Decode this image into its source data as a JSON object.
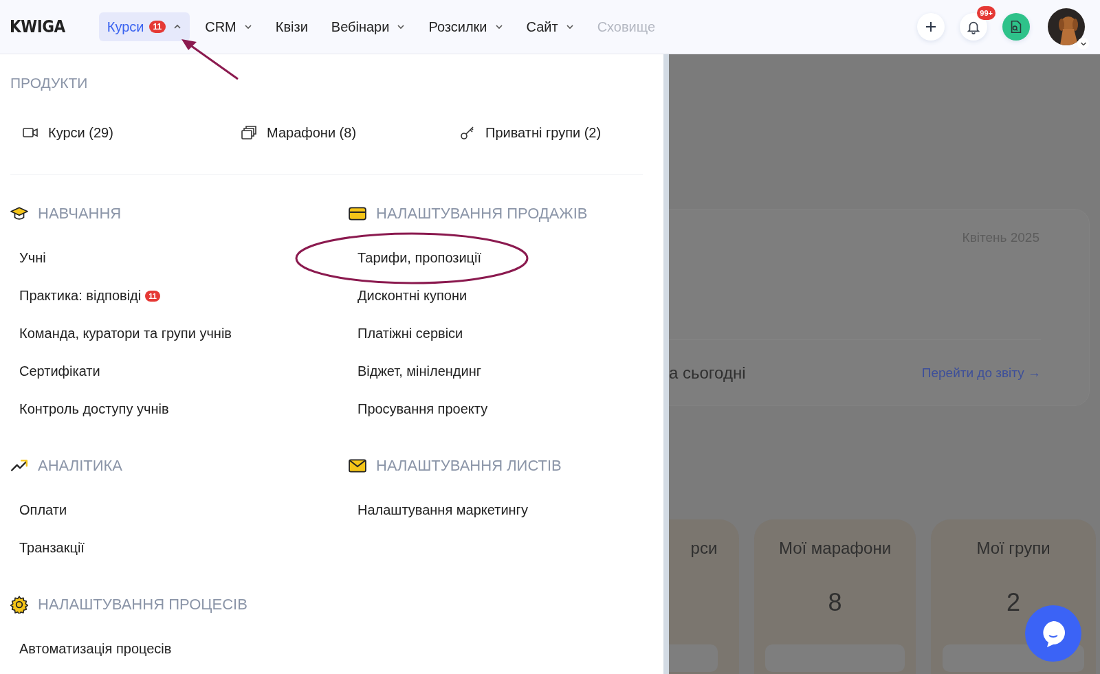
{
  "header": {
    "logo": "KWIGA",
    "nav": [
      {
        "label": "Курси",
        "badge": "11",
        "kind": "dropdown",
        "selected": true,
        "disabled": false
      },
      {
        "label": "CRM",
        "kind": "dropdown",
        "selected": false,
        "disabled": false
      },
      {
        "label": "Квізи",
        "kind": "link",
        "selected": false,
        "disabled": false
      },
      {
        "label": "Вебінари",
        "kind": "dropdown",
        "selected": false,
        "disabled": false
      },
      {
        "label": "Розсилки",
        "kind": "dropdown",
        "selected": false,
        "disabled": false
      },
      {
        "label": "Сайт",
        "kind": "dropdown",
        "selected": false,
        "disabled": false
      },
      {
        "label": "Сховище",
        "kind": "link",
        "selected": false,
        "disabled": true
      }
    ],
    "notifications_badge": "99+"
  },
  "menu": {
    "products_title": "ПРОДУКТИ",
    "products": [
      {
        "label": "Курси (29)"
      },
      {
        "label": "Марафони (8)"
      },
      {
        "label": "Приватні групи (2)"
      }
    ],
    "columns": [
      [
        {
          "title": "НАВЧАННЯ",
          "items": [
            {
              "label": "Учні"
            },
            {
              "label": "Практика: відповіді",
              "badge": "11"
            },
            {
              "label": "Команда, куратори та групи учнів"
            },
            {
              "label": "Сертифікати"
            },
            {
              "label": "Контроль доступу учнів"
            }
          ]
        },
        {
          "title": "АНАЛІТИКА",
          "items": [
            {
              "label": "Оплати"
            },
            {
              "label": "Транзакції"
            }
          ]
        },
        {
          "title": "НАЛАШТУВАННЯ ПРОЦЕСІВ",
          "items": [
            {
              "label": "Автоматизація процесів"
            }
          ]
        }
      ],
      [
        {
          "title": "НАЛАШТУВАННЯ ПРОДАЖІВ",
          "items": [
            {
              "label": "Тарифи, пропозиції",
              "circled": true
            },
            {
              "label": "Дисконтні купони"
            },
            {
              "label": "Платіжні сервіси"
            },
            {
              "label": "Віджет, мінілендинг"
            },
            {
              "label": "Просування проекту"
            }
          ]
        },
        {
          "title": "НАЛАШТУВАННЯ ЛИСТІВ",
          "items": [
            {
              "label": "Налаштування маркетингу"
            }
          ]
        }
      ]
    ]
  },
  "background": {
    "report": {
      "month": "Квітень 2025",
      "caption": "а сьогодні",
      "link": "Перейти до звіту →"
    },
    "cards": [
      {
        "title": "рси"
      },
      {
        "title": "Мої марафони",
        "value": "8"
      },
      {
        "title": "Мої групи",
        "value": "2"
      }
    ]
  }
}
